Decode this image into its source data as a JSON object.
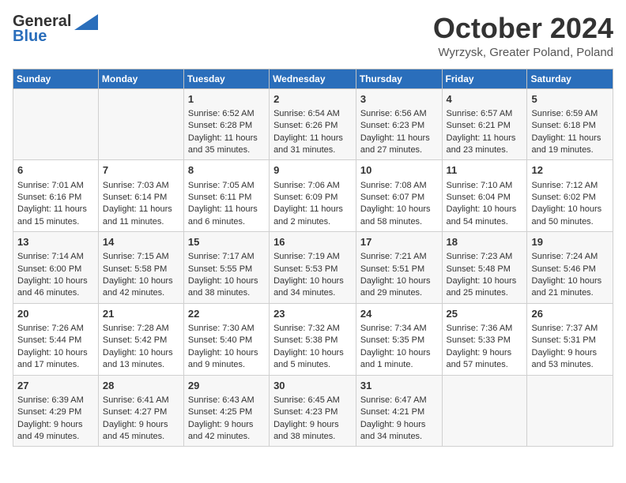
{
  "header": {
    "logo_line1": "General",
    "logo_line2": "Blue",
    "month_title": "October 2024",
    "location": "Wyrzysk, Greater Poland, Poland"
  },
  "calendar": {
    "days_of_week": [
      "Sunday",
      "Monday",
      "Tuesday",
      "Wednesday",
      "Thursday",
      "Friday",
      "Saturday"
    ],
    "weeks": [
      [
        {
          "day": "",
          "sunrise": "",
          "sunset": "",
          "daylight": ""
        },
        {
          "day": "",
          "sunrise": "",
          "sunset": "",
          "daylight": ""
        },
        {
          "day": "1",
          "sunrise": "Sunrise: 6:52 AM",
          "sunset": "Sunset: 6:28 PM",
          "daylight": "Daylight: 11 hours and 35 minutes."
        },
        {
          "day": "2",
          "sunrise": "Sunrise: 6:54 AM",
          "sunset": "Sunset: 6:26 PM",
          "daylight": "Daylight: 11 hours and 31 minutes."
        },
        {
          "day": "3",
          "sunrise": "Sunrise: 6:56 AM",
          "sunset": "Sunset: 6:23 PM",
          "daylight": "Daylight: 11 hours and 27 minutes."
        },
        {
          "day": "4",
          "sunrise": "Sunrise: 6:57 AM",
          "sunset": "Sunset: 6:21 PM",
          "daylight": "Daylight: 11 hours and 23 minutes."
        },
        {
          "day": "5",
          "sunrise": "Sunrise: 6:59 AM",
          "sunset": "Sunset: 6:18 PM",
          "daylight": "Daylight: 11 hours and 19 minutes."
        }
      ],
      [
        {
          "day": "6",
          "sunrise": "Sunrise: 7:01 AM",
          "sunset": "Sunset: 6:16 PM",
          "daylight": "Daylight: 11 hours and 15 minutes."
        },
        {
          "day": "7",
          "sunrise": "Sunrise: 7:03 AM",
          "sunset": "Sunset: 6:14 PM",
          "daylight": "Daylight: 11 hours and 11 minutes."
        },
        {
          "day": "8",
          "sunrise": "Sunrise: 7:05 AM",
          "sunset": "Sunset: 6:11 PM",
          "daylight": "Daylight: 11 hours and 6 minutes."
        },
        {
          "day": "9",
          "sunrise": "Sunrise: 7:06 AM",
          "sunset": "Sunset: 6:09 PM",
          "daylight": "Daylight: 11 hours and 2 minutes."
        },
        {
          "day": "10",
          "sunrise": "Sunrise: 7:08 AM",
          "sunset": "Sunset: 6:07 PM",
          "daylight": "Daylight: 10 hours and 58 minutes."
        },
        {
          "day": "11",
          "sunrise": "Sunrise: 7:10 AM",
          "sunset": "Sunset: 6:04 PM",
          "daylight": "Daylight: 10 hours and 54 minutes."
        },
        {
          "day": "12",
          "sunrise": "Sunrise: 7:12 AM",
          "sunset": "Sunset: 6:02 PM",
          "daylight": "Daylight: 10 hours and 50 minutes."
        }
      ],
      [
        {
          "day": "13",
          "sunrise": "Sunrise: 7:14 AM",
          "sunset": "Sunset: 6:00 PM",
          "daylight": "Daylight: 10 hours and 46 minutes."
        },
        {
          "day": "14",
          "sunrise": "Sunrise: 7:15 AM",
          "sunset": "Sunset: 5:58 PM",
          "daylight": "Daylight: 10 hours and 42 minutes."
        },
        {
          "day": "15",
          "sunrise": "Sunrise: 7:17 AM",
          "sunset": "Sunset: 5:55 PM",
          "daylight": "Daylight: 10 hours and 38 minutes."
        },
        {
          "day": "16",
          "sunrise": "Sunrise: 7:19 AM",
          "sunset": "Sunset: 5:53 PM",
          "daylight": "Daylight: 10 hours and 34 minutes."
        },
        {
          "day": "17",
          "sunrise": "Sunrise: 7:21 AM",
          "sunset": "Sunset: 5:51 PM",
          "daylight": "Daylight: 10 hours and 29 minutes."
        },
        {
          "day": "18",
          "sunrise": "Sunrise: 7:23 AM",
          "sunset": "Sunset: 5:48 PM",
          "daylight": "Daylight: 10 hours and 25 minutes."
        },
        {
          "day": "19",
          "sunrise": "Sunrise: 7:24 AM",
          "sunset": "Sunset: 5:46 PM",
          "daylight": "Daylight: 10 hours and 21 minutes."
        }
      ],
      [
        {
          "day": "20",
          "sunrise": "Sunrise: 7:26 AM",
          "sunset": "Sunset: 5:44 PM",
          "daylight": "Daylight: 10 hours and 17 minutes."
        },
        {
          "day": "21",
          "sunrise": "Sunrise: 7:28 AM",
          "sunset": "Sunset: 5:42 PM",
          "daylight": "Daylight: 10 hours and 13 minutes."
        },
        {
          "day": "22",
          "sunrise": "Sunrise: 7:30 AM",
          "sunset": "Sunset: 5:40 PM",
          "daylight": "Daylight: 10 hours and 9 minutes."
        },
        {
          "day": "23",
          "sunrise": "Sunrise: 7:32 AM",
          "sunset": "Sunset: 5:38 PM",
          "daylight": "Daylight: 10 hours and 5 minutes."
        },
        {
          "day": "24",
          "sunrise": "Sunrise: 7:34 AM",
          "sunset": "Sunset: 5:35 PM",
          "daylight": "Daylight: 10 hours and 1 minute."
        },
        {
          "day": "25",
          "sunrise": "Sunrise: 7:36 AM",
          "sunset": "Sunset: 5:33 PM",
          "daylight": "Daylight: 9 hours and 57 minutes."
        },
        {
          "day": "26",
          "sunrise": "Sunrise: 7:37 AM",
          "sunset": "Sunset: 5:31 PM",
          "daylight": "Daylight: 9 hours and 53 minutes."
        }
      ],
      [
        {
          "day": "27",
          "sunrise": "Sunrise: 6:39 AM",
          "sunset": "Sunset: 4:29 PM",
          "daylight": "Daylight: 9 hours and 49 minutes."
        },
        {
          "day": "28",
          "sunrise": "Sunrise: 6:41 AM",
          "sunset": "Sunset: 4:27 PM",
          "daylight": "Daylight: 9 hours and 45 minutes."
        },
        {
          "day": "29",
          "sunrise": "Sunrise: 6:43 AM",
          "sunset": "Sunset: 4:25 PM",
          "daylight": "Daylight: 9 hours and 42 minutes."
        },
        {
          "day": "30",
          "sunrise": "Sunrise: 6:45 AM",
          "sunset": "Sunset: 4:23 PM",
          "daylight": "Daylight: 9 hours and 38 minutes."
        },
        {
          "day": "31",
          "sunrise": "Sunrise: 6:47 AM",
          "sunset": "Sunset: 4:21 PM",
          "daylight": "Daylight: 9 hours and 34 minutes."
        },
        {
          "day": "",
          "sunrise": "",
          "sunset": "",
          "daylight": ""
        },
        {
          "day": "",
          "sunrise": "",
          "sunset": "",
          "daylight": ""
        }
      ]
    ]
  }
}
